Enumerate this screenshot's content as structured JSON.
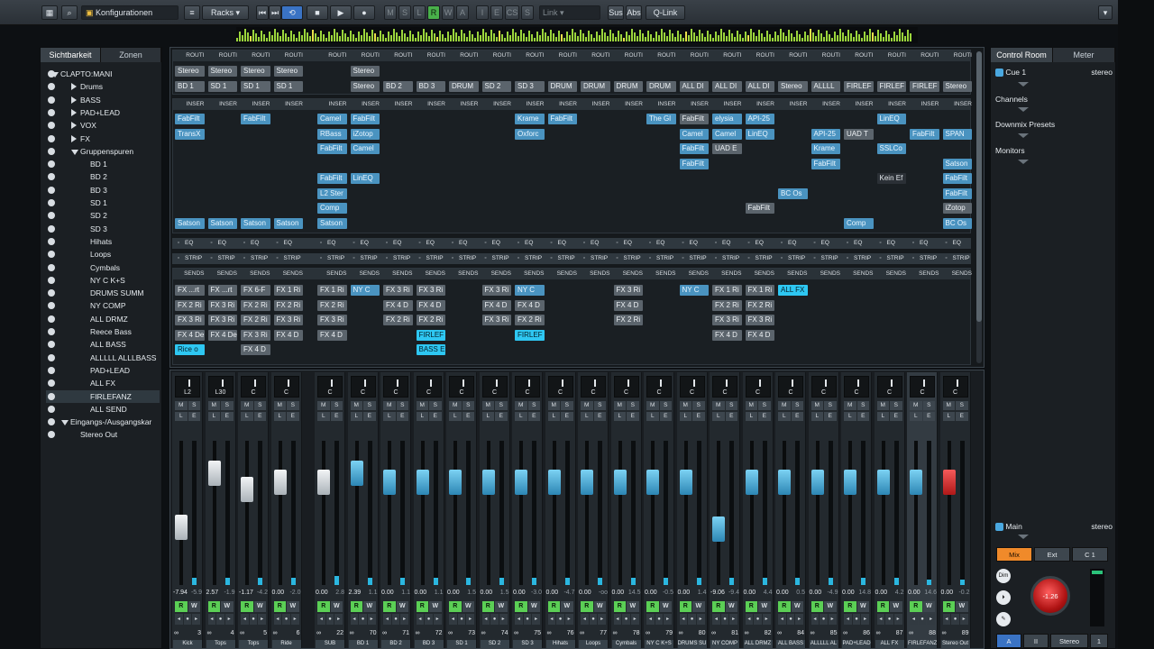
{
  "toolbar": {
    "config_label": "Konfigurationen",
    "racks_label": "Racks",
    "state_buttons": [
      "M",
      "S",
      "L",
      "R",
      "W",
      "A"
    ],
    "edit_buttons": [
      "I",
      "E",
      "CS",
      "S"
    ],
    "link_label": "Link",
    "sus_label": "Sus",
    "abs_label": "Abs",
    "qlink_label": "Q-Link"
  },
  "left_panel": {
    "tabs": [
      "Sichtbarkeit",
      "Zonen"
    ],
    "tree": [
      {
        "label": "CLAPTO:MANI",
        "indent": 0,
        "arrow": "down"
      },
      {
        "label": "Drums",
        "indent": 2,
        "arrow": "right"
      },
      {
        "label": "BASS",
        "indent": 2,
        "arrow": "right"
      },
      {
        "label": "PAD+LEAD",
        "indent": 2,
        "arrow": "right"
      },
      {
        "label": "VOX",
        "indent": 2,
        "arrow": "right"
      },
      {
        "label": "FX",
        "indent": 2,
        "arrow": "right"
      },
      {
        "label": "Gruppenspuren",
        "indent": 2,
        "arrow": "down"
      },
      {
        "label": "BD 1",
        "indent": 3
      },
      {
        "label": "BD 2",
        "indent": 3
      },
      {
        "label": "BD 3",
        "indent": 3
      },
      {
        "label": "SD 1",
        "indent": 3
      },
      {
        "label": "SD 2",
        "indent": 3
      },
      {
        "label": "SD 3",
        "indent": 3
      },
      {
        "label": "Hihats",
        "indent": 3
      },
      {
        "label": "Loops",
        "indent": 3
      },
      {
        "label": "Cymbals",
        "indent": 3
      },
      {
        "label": "NY C K+S",
        "indent": 3
      },
      {
        "label": "DRUMS SUMM",
        "indent": 3
      },
      {
        "label": "NY COMP",
        "indent": 3
      },
      {
        "label": "ALL DRMZ",
        "indent": 3
      },
      {
        "label": "Reece Bass",
        "indent": 3
      },
      {
        "label": "ALL BASS",
        "indent": 3
      },
      {
        "label": "ALLLLL ALLLBASS",
        "indent": 3
      },
      {
        "label": "PAD+LEAD",
        "indent": 3
      },
      {
        "label": "ALL FX",
        "indent": 3
      },
      {
        "label": "FIRLEFANZ",
        "indent": 3,
        "selected": true
      },
      {
        "label": "ALL SEND",
        "indent": 3
      },
      {
        "label": "Eingangs-/Ausgangskar",
        "indent": 1,
        "arrow": "down"
      },
      {
        "label": "Stereo Out",
        "indent": 2
      }
    ]
  },
  "rack": {
    "routing_header": "ROUTI",
    "inserts_header": "INSER",
    "eq_label": "EQ",
    "strip_label": "STRIP",
    "sends_label": "SENDS",
    "routing_in": [
      "Stereo",
      "Stereo",
      "Stereo",
      "Stereo",
      "",
      "Stereo"
    ],
    "routing_out": [
      "BD 1",
      "SD 1",
      "SD 1",
      "SD 1",
      "",
      "Stereo",
      "BD 2",
      "BD 3",
      "DRUM",
      "SD 2",
      "SD 3",
      "DRUM",
      "DRUM",
      "DRUM",
      "DRUM",
      "ALL DI",
      "ALL DI",
      "ALL DI",
      "Stereo",
      "ALLLL",
      "FIRLEF",
      "FIRLEF",
      "FIRLEF",
      "Stereo"
    ],
    "inserts": [
      {
        "col": 0,
        "row": 0,
        "text": "FabFilt"
      },
      {
        "col": 0,
        "row": 1,
        "text": "TransX"
      },
      {
        "col": 0,
        "row": 7,
        "text": "Satson"
      },
      {
        "col": 1,
        "row": 7,
        "text": "Satson"
      },
      {
        "col": 2,
        "row": 0,
        "text": "FabFilt"
      },
      {
        "col": 2,
        "row": 7,
        "text": "Satson"
      },
      {
        "col": 3,
        "row": 7,
        "text": "Satson"
      },
      {
        "col": 4,
        "row": 0,
        "text": "Camel"
      },
      {
        "col": 4,
        "row": 1,
        "text": "RBass"
      },
      {
        "col": 4,
        "row": 2,
        "text": "FabFilt"
      },
      {
        "col": 4,
        "row": 4,
        "text": "FabFilt"
      },
      {
        "col": 4,
        "row": 5,
        "text": "L2 Ster"
      },
      {
        "col": 4,
        "row": 6,
        "text": "Comp"
      },
      {
        "col": 4,
        "row": 7,
        "text": "Satson"
      },
      {
        "col": 5,
        "row": 0,
        "text": "FabFilt"
      },
      {
        "col": 5,
        "row": 1,
        "text": "iZotop"
      },
      {
        "col": 5,
        "row": 2,
        "text": "Camel"
      },
      {
        "col": 5,
        "row": 4,
        "text": "LinEQ"
      },
      {
        "col": 10,
        "row": 0,
        "text": "Krame"
      },
      {
        "col": 10,
        "row": 1,
        "text": "Oxforc"
      },
      {
        "col": 11,
        "row": 0,
        "text": "FabFilt"
      },
      {
        "col": 14,
        "row": 0,
        "text": "The Gl"
      },
      {
        "col": 15,
        "row": 0,
        "text": "FabFilt",
        "style": "grey"
      },
      {
        "col": 15,
        "row": 1,
        "text": "Camel"
      },
      {
        "col": 15,
        "row": 2,
        "text": "FabFilt"
      },
      {
        "col": 15,
        "row": 3,
        "text": "FabFilt"
      },
      {
        "col": 16,
        "row": 0,
        "text": "elysia"
      },
      {
        "col": 16,
        "row": 1,
        "text": "Camel"
      },
      {
        "col": 16,
        "row": 2,
        "text": "UAD E",
        "style": "grey"
      },
      {
        "col": 17,
        "row": 0,
        "text": "API-25"
      },
      {
        "col": 17,
        "row": 1,
        "text": "LinEQ"
      },
      {
        "col": 17,
        "row": 6,
        "text": "FabFilt",
        "style": "grey"
      },
      {
        "col": 18,
        "row": 5,
        "text": "BC Os"
      },
      {
        "col": 19,
        "row": 1,
        "text": "API-25"
      },
      {
        "col": 19,
        "row": 2,
        "text": "Krame"
      },
      {
        "col": 19,
        "row": 3,
        "text": "FabFilt"
      },
      {
        "col": 20,
        "row": 1,
        "text": "UAD T",
        "style": "grey"
      },
      {
        "col": 20,
        "row": 7,
        "text": "Comp"
      },
      {
        "col": 21,
        "row": 0,
        "text": "LinEQ"
      },
      {
        "col": 21,
        "row": 2,
        "text": "SSLCo"
      },
      {
        "col": 21,
        "row": 4,
        "text": "Kein Ef",
        "style": "darkslot"
      },
      {
        "col": 22,
        "row": 1,
        "text": "FabFilt"
      },
      {
        "col": 23,
        "row": 1,
        "text": "SPAN"
      },
      {
        "col": 23,
        "row": 3,
        "text": "Satson"
      },
      {
        "col": 23,
        "row": 4,
        "text": "FabFilt"
      },
      {
        "col": 23,
        "row": 5,
        "text": "FabFilt"
      },
      {
        "col": 23,
        "row": 6,
        "text": "iZotop",
        "style": "grey"
      },
      {
        "col": 23,
        "row": 7,
        "text": "BC Os"
      }
    ],
    "sends": [
      {
        "col": 0,
        "row": 0,
        "text": "FX ...rt",
        "style": "grey"
      },
      {
        "col": 0,
        "row": 1,
        "text": "FX 2 Ri",
        "style": "grey"
      },
      {
        "col": 0,
        "row": 2,
        "text": "FX 3 Ri",
        "style": "grey"
      },
      {
        "col": 0,
        "row": 3,
        "text": "FX 4 De",
        "style": "grey"
      },
      {
        "col": 0,
        "row": 4,
        "text": "Rice o",
        "style": "cyan"
      },
      {
        "col": 1,
        "row": 0,
        "text": "FX ...rt",
        "style": "grey"
      },
      {
        "col": 1,
        "row": 1,
        "text": "FX 3 Ri",
        "style": "grey"
      },
      {
        "col": 1,
        "row": 2,
        "text": "FX 3 Ri",
        "style": "grey"
      },
      {
        "col": 1,
        "row": 3,
        "text": "FX 4 De",
        "style": "grey"
      },
      {
        "col": 2,
        "row": 0,
        "text": "FX 6-F",
        "style": "grey"
      },
      {
        "col": 2,
        "row": 1,
        "text": "FX 2 Ri",
        "style": "grey"
      },
      {
        "col": 2,
        "row": 2,
        "text": "FX 2 Ri",
        "style": "grey"
      },
      {
        "col": 2,
        "row": 3,
        "text": "FX 3 Ri",
        "style": "grey"
      },
      {
        "col": 2,
        "row": 4,
        "text": "FX 4 D",
        "style": "grey"
      },
      {
        "col": 3,
        "row": 0,
        "text": "FX 1 Ri",
        "style": "grey"
      },
      {
        "col": 3,
        "row": 1,
        "text": "FX 2 Ri",
        "style": "grey"
      },
      {
        "col": 3,
        "row": 2,
        "text": "FX 3 Ri",
        "style": "grey"
      },
      {
        "col": 3,
        "row": 3,
        "text": "FX 4 D",
        "style": "grey"
      },
      {
        "col": 4,
        "row": 0,
        "text": "FX 1 Ri",
        "style": "grey"
      },
      {
        "col": 4,
        "row": 1,
        "text": "FX 2 Ri",
        "style": "grey"
      },
      {
        "col": 4,
        "row": 2,
        "text": "FX 3 Ri",
        "style": "grey"
      },
      {
        "col": 4,
        "row": 3,
        "text": "FX 4 D",
        "style": "grey"
      },
      {
        "col": 5,
        "row": 0,
        "text": "NY C",
        "style": "blue"
      },
      {
        "col": 6,
        "row": 0,
        "text": "FX 3 Ri",
        "style": "grey"
      },
      {
        "col": 6,
        "row": 1,
        "text": "FX 4 D",
        "style": "grey"
      },
      {
        "col": 6,
        "row": 2,
        "text": "FX 2 Ri",
        "style": "grey"
      },
      {
        "col": 7,
        "row": 0,
        "text": "FX 3 Ri",
        "style": "grey"
      },
      {
        "col": 7,
        "row": 1,
        "text": "FX 4 D",
        "style": "grey"
      },
      {
        "col": 7,
        "row": 2,
        "text": "FX 2 Ri",
        "style": "grey"
      },
      {
        "col": 7,
        "row": 3,
        "text": "FIRLEF",
        "style": "cyan"
      },
      {
        "col": 7,
        "row": 4,
        "text": "BASS E",
        "style": "cyan"
      },
      {
        "col": 9,
        "row": 0,
        "text": "FX 3 Ri",
        "style": "grey"
      },
      {
        "col": 9,
        "row": 1,
        "text": "FX 4 D",
        "style": "grey"
      },
      {
        "col": 9,
        "row": 2,
        "text": "FX 3 Ri",
        "style": "grey"
      },
      {
        "col": 10,
        "row": 0,
        "text": "NY C",
        "style": "blue"
      },
      {
        "col": 10,
        "row": 1,
        "text": "FX 4 D",
        "style": "grey"
      },
      {
        "col": 10,
        "row": 2,
        "text": "FX 2 Ri",
        "style": "grey"
      },
      {
        "col": 10,
        "row": 3,
        "text": "FIRLEF",
        "style": "cyan"
      },
      {
        "col": 13,
        "row": 0,
        "text": "FX 3 Ri",
        "style": "grey"
      },
      {
        "col": 13,
        "row": 1,
        "text": "FX 4 D",
        "style": "grey"
      },
      {
        "col": 13,
        "row": 2,
        "text": "FX 2 Ri",
        "style": "grey"
      },
      {
        "col": 15,
        "row": 0,
        "text": "NY C",
        "style": "blue"
      },
      {
        "col": 16,
        "row": 0,
        "text": "FX 1 Ri",
        "style": "grey"
      },
      {
        "col": 16,
        "row": 1,
        "text": "FX 2 Ri",
        "style": "grey"
      },
      {
        "col": 16,
        "row": 2,
        "text": "FX 3 Ri",
        "style": "grey"
      },
      {
        "col": 16,
        "row": 3,
        "text": "FX 4 D",
        "style": "grey"
      },
      {
        "col": 17,
        "row": 0,
        "text": "FX 1 Ri",
        "style": "grey"
      },
      {
        "col": 17,
        "row": 1,
        "text": "FX 2 Ri",
        "style": "grey"
      },
      {
        "col": 17,
        "row": 2,
        "text": "FX 3 Ri",
        "style": "grey"
      },
      {
        "col": 17,
        "row": 3,
        "text": "FX 4 D",
        "style": "grey"
      },
      {
        "col": 18,
        "row": 0,
        "text": "ALL FX",
        "style": "cyan"
      }
    ]
  },
  "channels": [
    {
      "pan": "L2",
      "vol": "-7.94",
      "peak": "-5.9",
      "num": "3",
      "name": "Kick",
      "cap": "white",
      "level": 0.38,
      "meter": 0.05
    },
    {
      "pan": "L30",
      "vol": "2.57",
      "peak": "-1.9",
      "num": "4",
      "name": "Tops",
      "cap": "white",
      "level": 0.83,
      "meter": 0.05
    },
    {
      "pan": "C",
      "vol": "-1.17",
      "peak": "-4.2",
      "num": "5",
      "name": "Tops",
      "cap": "white",
      "level": 0.7,
      "meter": 0.05
    },
    {
      "pan": "C",
      "vol": "0.00",
      "peak": "-2.0",
      "num": "6",
      "name": "Ride",
      "cap": "white",
      "level": 0.76,
      "meter": 0.05
    },
    {
      "pan": "C",
      "vol": "0.00",
      "peak": "2.8",
      "num": "22",
      "name": "SUB",
      "cap": "white",
      "level": 0.76,
      "meter": 0.06
    },
    {
      "pan": "C",
      "vol": "2.39",
      "peak": "1.1",
      "num": "70",
      "name": "BD 1",
      "cap": "blue",
      "level": 0.83,
      "meter": 0.05
    },
    {
      "pan": "C",
      "vol": "0.00",
      "peak": "1.1",
      "num": "71",
      "name": "BD 2",
      "cap": "blue",
      "level": 0.76,
      "meter": 0.05
    },
    {
      "pan": "C",
      "vol": "0.00",
      "peak": "1.1",
      "num": "72",
      "name": "BD 3",
      "cap": "blue",
      "level": 0.76,
      "meter": 0.05
    },
    {
      "pan": "C",
      "vol": "0.00",
      "peak": "1.5",
      "num": "73",
      "name": "SD 1",
      "cap": "blue",
      "level": 0.76,
      "meter": 0.05
    },
    {
      "pan": "C",
      "vol": "0.00",
      "peak": "1.5",
      "num": "74",
      "name": "SD 2",
      "cap": "blue",
      "level": 0.76,
      "meter": 0.05
    },
    {
      "pan": "C",
      "vol": "0.00",
      "peak": "-3.0",
      "num": "75",
      "name": "SD 3",
      "cap": "blue",
      "level": 0.76,
      "meter": 0.05
    },
    {
      "pan": "C",
      "vol": "0.00",
      "peak": "-4.7",
      "num": "76",
      "name": "Hihats",
      "cap": "blue",
      "level": 0.76,
      "meter": 0.05
    },
    {
      "pan": "C",
      "vol": "0.00",
      "peak": "-oo",
      "num": "77",
      "name": "Loops",
      "cap": "blue",
      "level": 0.76,
      "meter": 0.05
    },
    {
      "pan": "C",
      "vol": "0.00",
      "peak": "14.5",
      "num": "78",
      "name": "Cymbals",
      "cap": "blue",
      "level": 0.76,
      "meter": 0.05
    },
    {
      "pan": "C",
      "vol": "0.00",
      "peak": "-0.5",
      "num": "79",
      "name": "NY C K+S",
      "cap": "blue",
      "level": 0.76,
      "meter": 0.05
    },
    {
      "pan": "C",
      "vol": "0.00",
      "peak": "1.4",
      "num": "80",
      "name": "DRUMS SU",
      "cap": "blue",
      "level": 0.76,
      "meter": 0.05
    },
    {
      "pan": "C",
      "vol": "-9.06",
      "peak": "-9.4",
      "num": "81",
      "name": "NY COMP",
      "cap": "blue",
      "level": 0.36,
      "meter": 0.05
    },
    {
      "pan": "C",
      "vol": "0.00",
      "peak": "4.4",
      "num": "82",
      "name": "ALL DRMZ",
      "cap": "blue",
      "level": 0.76,
      "meter": 0.05
    },
    {
      "pan": "C",
      "vol": "0.00",
      "peak": "0.5",
      "num": "84",
      "name": "ALL BASS",
      "cap": "blue",
      "level": 0.76,
      "meter": 0.05
    },
    {
      "pan": "C",
      "vol": "0.00",
      "peak": "-4.9",
      "num": "85",
      "name": "ALLLLL AL",
      "cap": "blue",
      "level": 0.76,
      "meter": 0.05
    },
    {
      "pan": "C",
      "vol": "0.00",
      "peak": "14.8",
      "num": "86",
      "name": "PAD+LEAD",
      "cap": "blue",
      "level": 0.76,
      "meter": 0.05
    },
    {
      "pan": "C",
      "vol": "0.00",
      "peak": "4.2",
      "num": "87",
      "name": "ALL FX",
      "cap": "blue",
      "level": 0.76,
      "meter": 0.05
    },
    {
      "pan": "C",
      "vol": "0.00",
      "peak": "14.6",
      "num": "88",
      "name": "FIRLEFANZ",
      "cap": "blue",
      "level": 0.76,
      "meter": 0.04,
      "selected": true
    },
    {
      "pan": "C",
      "vol": "0.00",
      "peak": "-0.2",
      "num": "89",
      "name": "Stereo Out",
      "cap": "red",
      "level": 0.76,
      "meter": 0.04
    }
  ],
  "control_room": {
    "tabs": [
      "Control Room",
      "Meter"
    ],
    "cue_label": "Cue 1",
    "cue_format": "stereo",
    "sections": [
      "Channels",
      "Downmix Presets",
      "Monitors"
    ],
    "main_label": "Main",
    "main_format": "stereo",
    "source_buttons": [
      "Mix",
      "Ext",
      "C 1"
    ],
    "volume": "-1.26",
    "dim_label": "Dim",
    "bottom_buttons": [
      "A",
      "II",
      "Stereo",
      "1"
    ]
  }
}
